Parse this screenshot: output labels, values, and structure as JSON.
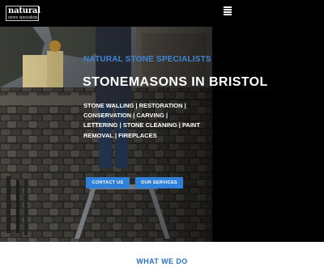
{
  "header": {
    "logo_main": "natural",
    "logo_sub": "stone specialists",
    "menu_icon": "hamburger-menu-icon"
  },
  "hero": {
    "kicker": "NATURAL STONE SPECIALISTS",
    "title": "STONEMASONS IN BRISTOL",
    "services_lines": [
      "STONE WALLING | RESTORATION |",
      "CONSERVATION | CARVING |",
      "LETTERING | STONE CLEANING | PAINT",
      "REMOVAL | FIREPLACES"
    ],
    "contact_button": "CONTACT US",
    "services_button": "OUR SERVICES"
  },
  "section": {
    "heading": "WHAT WE DO"
  },
  "colors": {
    "accent_blue": "#2f80d8",
    "kicker_blue": "#3f86d6",
    "heading_blue": "#2f71b8",
    "background": "#000000"
  }
}
